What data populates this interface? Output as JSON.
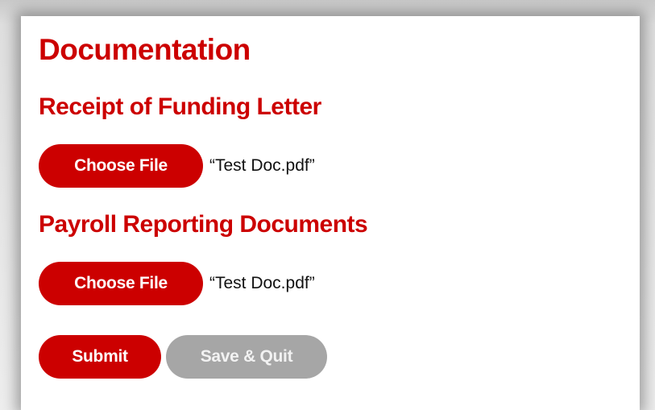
{
  "form": {
    "title": "Documentation",
    "sections": [
      {
        "heading": "Receipt of Funding Letter",
        "button_label": "Choose File",
        "file_name": "“Test Doc.pdf”"
      },
      {
        "heading": "Payroll Reporting Documents",
        "button_label": "Choose File",
        "file_name": "“Test Doc.pdf”"
      }
    ],
    "actions": {
      "submit_label": "Submit",
      "save_quit_label": "Save & Quit"
    }
  },
  "colors": {
    "accent": "#cc0000",
    "disabled": "#a6a6a6"
  }
}
